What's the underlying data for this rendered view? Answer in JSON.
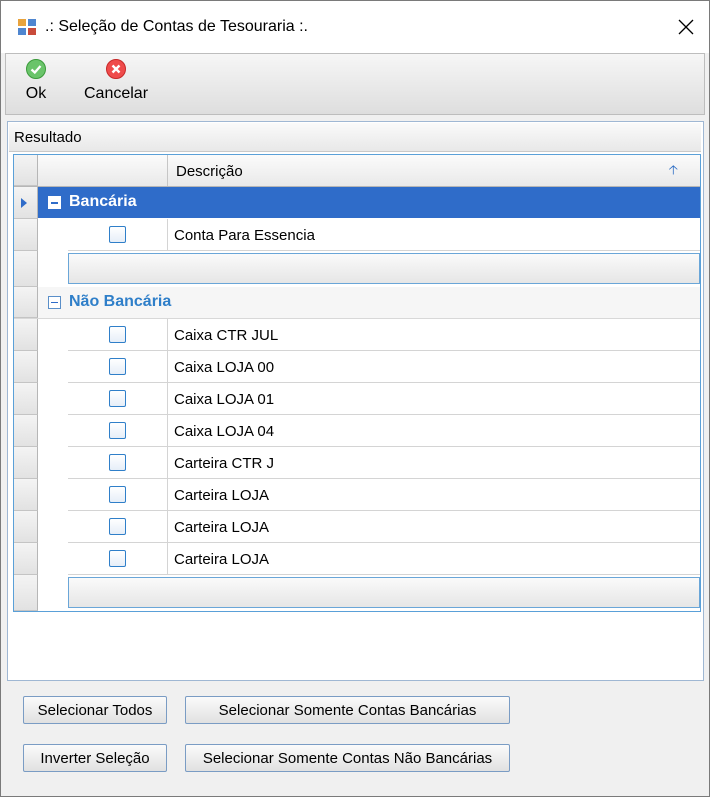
{
  "window": {
    "title": ".: Seleção de Contas de Tesouraria :."
  },
  "icons": {
    "app": "app-icon",
    "close": "close-icon",
    "ok": "check-circle-icon",
    "cancel": "x-circle-icon",
    "sort": "sort-ascending-icon",
    "group_toggle": "collapse-minus-icon",
    "row_indicator": "current-row-arrow-icon"
  },
  "toolbar": {
    "ok_label": "Ok",
    "cancel_label": "Cancelar"
  },
  "panel": {
    "header": "Resultado"
  },
  "grid": {
    "columns": [
      "",
      "Descrição"
    ],
    "groups": [
      {
        "title": "Bancária",
        "selected": true,
        "rows": [
          "Conta Para Essencia"
        ]
      },
      {
        "title": "Não Bancária",
        "selected": false,
        "rows": [
          "Caixa CTR JUL",
          "Caixa LOJA 00",
          "Caixa LOJA 01",
          "Caixa LOJA 04",
          "Carteira CTR J",
          "Carteira LOJA",
          "Carteira LOJA",
          "Carteira LOJA"
        ]
      }
    ]
  },
  "buttons": {
    "select_all": "Selecionar Todos",
    "invert": "Inverter Seleção",
    "only_bank": "Selecionar Somente Contas Bancárias",
    "only_non_bank": "Selecionar Somente Contas Não Bancárias"
  },
  "colors": {
    "selection": "#2f6cc9",
    "group_title": "#2f7fc9",
    "ok": "#3bb54a",
    "cancel": "#e53935"
  }
}
